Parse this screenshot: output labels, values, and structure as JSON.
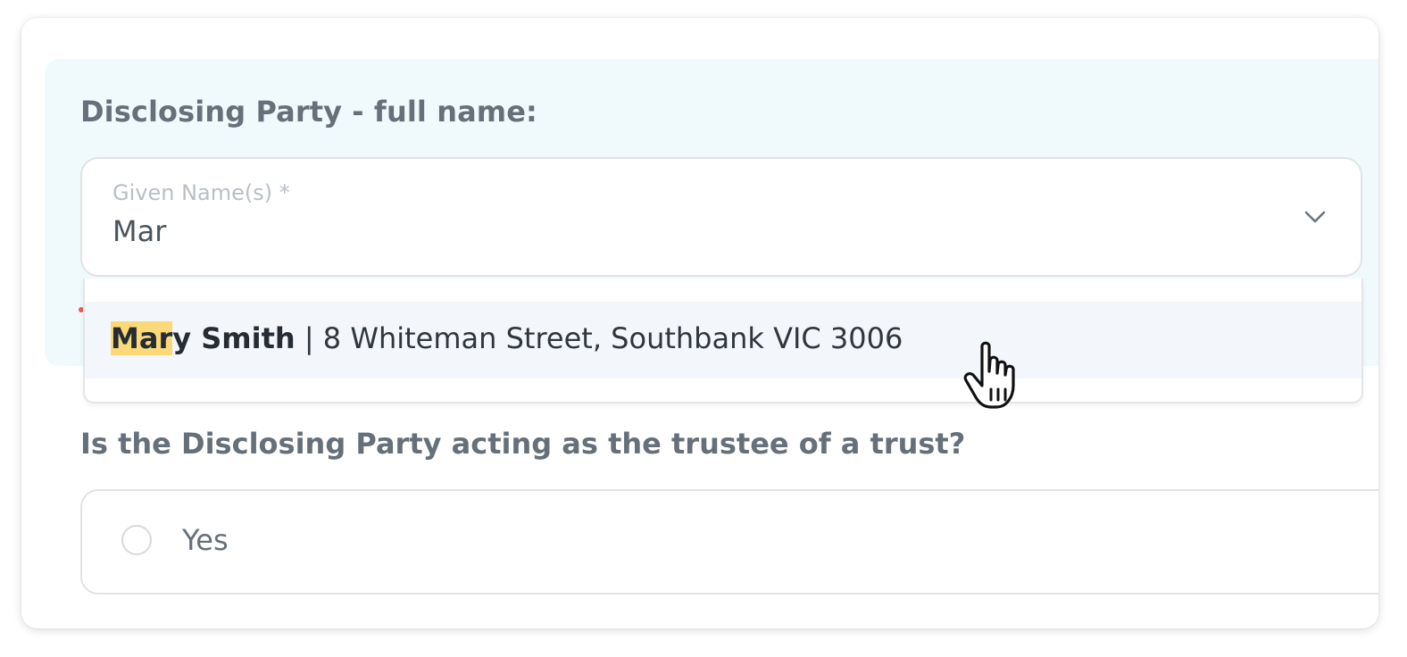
{
  "form": {
    "section_title": "Disclosing Party - full name:",
    "given_name": {
      "label": "Given Name(s) *",
      "value": "Mar"
    },
    "autocomplete": {
      "options": [
        {
          "name_match": "Mar",
          "name_rest": "y Smith",
          "separator": " | ",
          "address": "8 Whiteman Street, Southbank VIC 3006"
        }
      ]
    },
    "trust_question": {
      "label": "Is the Disclosing Party acting as the trustee of a trust?",
      "options": [
        {
          "label": "Yes",
          "selected": false
        }
      ]
    }
  },
  "colors": {
    "section_background": "#f0fafd",
    "highlight": "#fbd978",
    "heading_text": "#65707a",
    "option_hover": "#f3f7fc"
  },
  "icons": {
    "dropdown_toggle": "chevron-down-icon",
    "cursor": "hand-pointer-icon"
  }
}
